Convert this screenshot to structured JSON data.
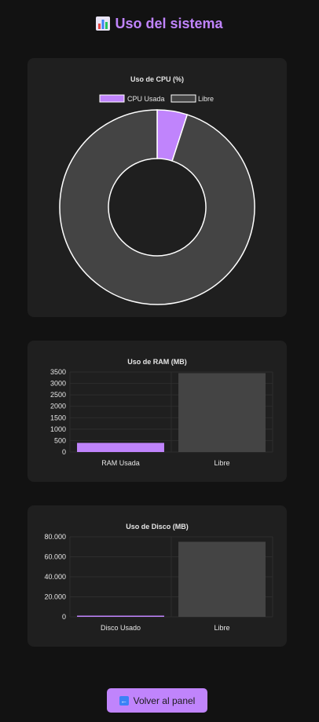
{
  "header": {
    "title": "Uso del sistema",
    "icon": "bar-chart-icon"
  },
  "colors": {
    "accent": "#c084fc",
    "free": "#444444",
    "background": "#121212",
    "card": "#1f1f1f"
  },
  "cpu": {
    "title": "Uso de CPU (%)",
    "legend": [
      "CPU Usada",
      "Libre"
    ]
  },
  "ram": {
    "title": "Uso de RAM (MB)",
    "yticks": [
      "3500",
      "3000",
      "2500",
      "2000",
      "1500",
      "1000",
      "500",
      "0"
    ],
    "categories": [
      "RAM Usada",
      "Libre"
    ]
  },
  "disk": {
    "title": "Uso de Disco (MB)",
    "yticks": [
      "80.000",
      "60.000",
      "40.000",
      "20.000",
      "0"
    ],
    "categories": [
      "Disco Usado",
      "Libre"
    ]
  },
  "chart_data": [
    {
      "type": "pie",
      "title": "Uso de CPU (%)",
      "categories": [
        "CPU Usada",
        "Libre"
      ],
      "values": [
        5,
        95
      ]
    },
    {
      "type": "bar",
      "title": "Uso de RAM (MB)",
      "categories": [
        "RAM Usada",
        "Libre"
      ],
      "values": [
        400,
        3450
      ],
      "ylim": [
        0,
        3500
      ]
    },
    {
      "type": "bar",
      "title": "Uso de Disco (MB)",
      "categories": [
        "Disco Usado",
        "Libre"
      ],
      "values": [
        1200,
        75000
      ],
      "ylim": [
        0,
        80000
      ]
    }
  ],
  "footer": {
    "back_label": "Volver al panel",
    "back_icon": "arrow-left-icon"
  }
}
